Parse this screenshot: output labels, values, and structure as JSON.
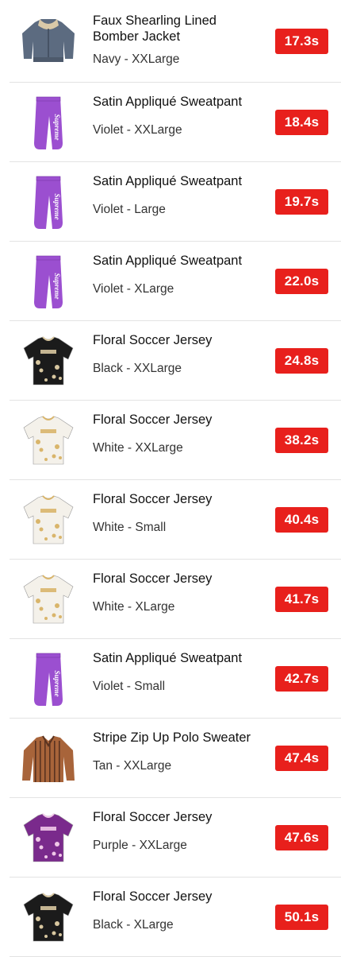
{
  "items": [
    {
      "title": "Faux Shearling Lined Bomber Jacket",
      "variant": "Navy - XXLarge",
      "time": "17.3s",
      "thumb": "jacket",
      "color": "#5c6b80",
      "accent": "#d9c9a8"
    },
    {
      "title": "Satin Appliqué Sweatpant",
      "variant": "Violet - XXLarge",
      "time": "18.4s",
      "thumb": "pants",
      "color": "#9b4fd0",
      "accent": "#ffffff"
    },
    {
      "title": "Satin Appliqué Sweatpant",
      "variant": "Violet - Large",
      "time": "19.7s",
      "thumb": "pants",
      "color": "#9b4fd0",
      "accent": "#ffffff"
    },
    {
      "title": "Satin Appliqué Sweatpant",
      "variant": "Violet - XLarge",
      "time": "22.0s",
      "thumb": "pants",
      "color": "#9b4fd0",
      "accent": "#ffffff"
    },
    {
      "title": "Floral Soccer Jersey",
      "variant": "Black - XXLarge",
      "time": "24.8s",
      "thumb": "jersey",
      "color": "#1b1b1b",
      "accent": "#d8c7a0"
    },
    {
      "title": "Floral Soccer Jersey",
      "variant": "White - XXLarge",
      "time": "38.2s",
      "thumb": "jersey",
      "color": "#f4f1ea",
      "accent": "#d9b56b"
    },
    {
      "title": "Floral Soccer Jersey",
      "variant": "White - Small",
      "time": "40.4s",
      "thumb": "jersey",
      "color": "#f4f1ea",
      "accent": "#d9b56b"
    },
    {
      "title": "Floral Soccer Jersey",
      "variant": "White - XLarge",
      "time": "41.7s",
      "thumb": "jersey",
      "color": "#f4f1ea",
      "accent": "#d9b56b"
    },
    {
      "title": "Satin Appliqué Sweatpant",
      "variant": "Violet - Small",
      "time": "42.7s",
      "thumb": "pants",
      "color": "#9b4fd0",
      "accent": "#ffffff"
    },
    {
      "title": "Stripe Zip Up Polo Sweater",
      "variant": "Tan - XXLarge",
      "time": "47.4s",
      "thumb": "sweater",
      "color": "#a8643a",
      "accent": "#5a3320"
    },
    {
      "title": "Floral Soccer Jersey",
      "variant": "Purple - XXLarge",
      "time": "47.6s",
      "thumb": "jersey",
      "color": "#7a2a8c",
      "accent": "#f0c8e8"
    },
    {
      "title": "Floral Soccer Jersey",
      "variant": "Black - XLarge",
      "time": "50.1s",
      "thumb": "jersey",
      "color": "#1b1b1b",
      "accent": "#d8c7a0"
    }
  ],
  "theme": {
    "badge_color": "#e8201c",
    "divider_color": "#e3e3e3"
  }
}
